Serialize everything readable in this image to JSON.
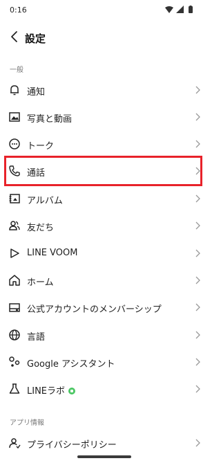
{
  "status": {
    "time": "0:16"
  },
  "header": {
    "title": "設定"
  },
  "sections": {
    "general": "一般",
    "app_info": "アプリ情報"
  },
  "items": [
    {
      "label": "通知",
      "icon": "bell-icon"
    },
    {
      "label": "写真と動画",
      "icon": "photo-icon"
    },
    {
      "label": "トーク",
      "icon": "chat-bubble-icon"
    },
    {
      "label": "通話",
      "icon": "phone-icon",
      "highlighted": true
    },
    {
      "label": "アルバム",
      "icon": "album-icon"
    },
    {
      "label": "友だち",
      "icon": "friends-icon"
    },
    {
      "label": "LINE VOOM",
      "icon": "play-icon"
    },
    {
      "label": "ホーム",
      "icon": "home-icon"
    },
    {
      "label": "公式アカウントのメンバーシップ",
      "icon": "membership-icon"
    },
    {
      "label": "言語",
      "icon": "globe-icon"
    },
    {
      "label": "Google アシスタント",
      "icon": "assistant-icon"
    },
    {
      "label": "LINEラボ",
      "icon": "flask-icon",
      "badge": "new"
    },
    {
      "label": "プライバシーポリシー",
      "icon": "privacy-icon"
    }
  ],
  "colors": {
    "highlight": "#e8222a",
    "badge": "#4cc764"
  }
}
